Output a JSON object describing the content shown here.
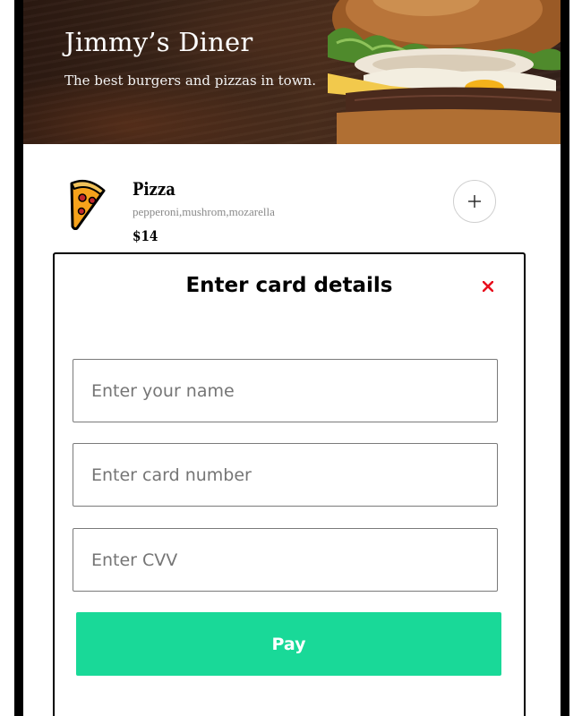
{
  "header": {
    "title": "Jimmy’s Diner",
    "subtitle": "The best burgers and pizzas in town.",
    "image_icon": "burger-image"
  },
  "menu": {
    "items": [
      {
        "name": "Pizza",
        "ingredients": "pepperoni,mushrom,mozarella",
        "price": "$14",
        "icon": "pizza-icon",
        "add_icon": "plus-icon"
      }
    ]
  },
  "modal": {
    "title": "Enter card details",
    "close_icon": "close-icon",
    "close_color": "#e8101e",
    "fields": {
      "name_placeholder": "Enter your name",
      "card_placeholder": "Enter card number",
      "cvv_placeholder": "Enter CVV"
    },
    "pay_label": "Pay",
    "pay_color": "#19d998"
  }
}
